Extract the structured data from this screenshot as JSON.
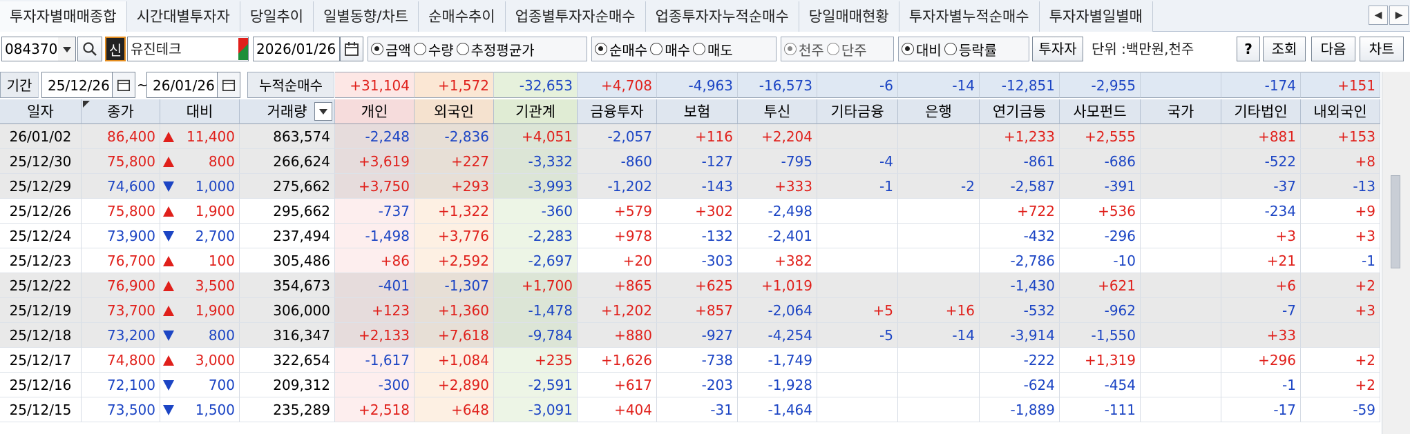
{
  "tabs": [
    "투자자별매매종합",
    "시간대별투자자",
    "당일추이",
    "일별동향/차트",
    "순매수추이",
    "업종별투자자순매수",
    "업종투자자누적순매수",
    "당일매매현황",
    "투자자별누적순매수",
    "투자자별일별매"
  ],
  "tab_arrows": {
    "left": "◀",
    "right": "▶"
  },
  "toolbar": {
    "code": "084370",
    "credit_badge": "신",
    "stock_name": "유진테크",
    "date": "2026/01/26",
    "unit_label": "단위 :백만원,천주",
    "investor_button": "투자자",
    "help_button": "?",
    "query_button": "조회",
    "next_button": "다음",
    "chart_button": "차트",
    "radio_groups": [
      [
        {
          "label": "금액",
          "checked": true
        },
        {
          "label": "수량",
          "checked": false
        },
        {
          "label": "추정평균가",
          "checked": false
        }
      ],
      [
        {
          "label": "순매수",
          "checked": true
        },
        {
          "label": "매수",
          "checked": false
        },
        {
          "label": "매도",
          "checked": false
        }
      ],
      [
        {
          "label": "천주",
          "checked": true
        },
        {
          "label": "단주",
          "checked": false
        }
      ],
      [
        {
          "label": "대비",
          "checked": true
        },
        {
          "label": "등락률",
          "checked": false
        }
      ]
    ]
  },
  "period": {
    "label": "기간",
    "from": "25/12/26",
    "tilde": "~",
    "to": "26/01/26",
    "cumulative_label": "누적순매수"
  },
  "summary_values": [
    "+31,104",
    "+1,572",
    "-32,653",
    "+4,708",
    "-4,963",
    "-16,573",
    "-6",
    "-14",
    "-12,851",
    "-2,955",
    "",
    "-174",
    "+151"
  ],
  "columns": [
    "일자",
    "종가",
    "대비",
    "거래량",
    "개인",
    "외국인",
    "기관계",
    "금융투자",
    "보험",
    "투신",
    "기타금융",
    "은행",
    "연기금등",
    "사모펀드",
    "국가",
    "기타법인",
    "내외국인"
  ],
  "rows": [
    {
      "date": "26/01/02",
      "close": "86,400",
      "dir": "up",
      "change": "11,400",
      "volume": "863,574",
      "vals": [
        "-2,248",
        "-2,836",
        "+4,051",
        "-2,057",
        "+116",
        "+2,204",
        "",
        "",
        "+1,233",
        "+2,555",
        "",
        "+881",
        "+153"
      ]
    },
    {
      "date": "25/12/30",
      "close": "75,800",
      "dir": "up",
      "change": "800",
      "volume": "266,624",
      "vals": [
        "+3,619",
        "+227",
        "-3,332",
        "-860",
        "-127",
        "-795",
        "-4",
        "",
        "-861",
        "-686",
        "",
        "-522",
        "+8"
      ]
    },
    {
      "date": "25/12/29",
      "close": "74,600",
      "dir": "down",
      "change": "1,000",
      "volume": "275,662",
      "vals": [
        "+3,750",
        "+293",
        "-3,993",
        "-1,202",
        "-143",
        "+333",
        "-1",
        "-2",
        "-2,587",
        "-391",
        "",
        "-37",
        "-13"
      ]
    },
    {
      "date": "25/12/26",
      "close": "75,800",
      "dir": "up",
      "change": "1,900",
      "volume": "295,662",
      "vals": [
        "-737",
        "+1,322",
        "-360",
        "+579",
        "+302",
        "-2,498",
        "",
        "",
        "+722",
        "+536",
        "",
        "-234",
        "+9"
      ]
    },
    {
      "date": "25/12/24",
      "close": "73,900",
      "dir": "down",
      "change": "2,700",
      "volume": "237,494",
      "vals": [
        "-1,498",
        "+3,776",
        "-2,283",
        "+978",
        "-132",
        "-2,401",
        "",
        "",
        "-432",
        "-296",
        "",
        "+3",
        "+3"
      ]
    },
    {
      "date": "25/12/23",
      "close": "76,700",
      "dir": "up",
      "change": "100",
      "volume": "305,486",
      "vals": [
        "+86",
        "+2,592",
        "-2,697",
        "+20",
        "-303",
        "+382",
        "",
        "",
        "-2,786",
        "-10",
        "",
        "+21",
        "-1"
      ]
    },
    {
      "date": "25/12/22",
      "close": "76,900",
      "dir": "up",
      "change": "3,500",
      "volume": "354,673",
      "vals": [
        "-401",
        "-1,307",
        "+1,700",
        "+865",
        "+625",
        "+1,019",
        "",
        "",
        "-1,430",
        "+621",
        "",
        "+6",
        "+2"
      ]
    },
    {
      "date": "25/12/19",
      "close": "73,700",
      "dir": "up",
      "change": "1,900",
      "volume": "306,000",
      "vals": [
        "+123",
        "+1,360",
        "-1,478",
        "+1,202",
        "+857",
        "-2,064",
        "+5",
        "+16",
        "-532",
        "-962",
        "",
        "-7",
        "+3"
      ]
    },
    {
      "date": "25/12/18",
      "close": "73,200",
      "dir": "down",
      "change": "800",
      "volume": "316,347",
      "vals": [
        "+2,133",
        "+7,618",
        "-9,784",
        "+880",
        "-927",
        "-4,254",
        "-5",
        "-14",
        "-3,914",
        "-1,550",
        "",
        "+33",
        ""
      ]
    },
    {
      "date": "25/12/17",
      "close": "74,800",
      "dir": "up",
      "change": "3,000",
      "volume": "322,654",
      "vals": [
        "-1,617",
        "+1,084",
        "+235",
        "+1,626",
        "-738",
        "-1,749",
        "",
        "",
        "-222",
        "+1,319",
        "",
        "+296",
        "+2"
      ]
    },
    {
      "date": "25/12/16",
      "close": "72,100",
      "dir": "down",
      "change": "700",
      "volume": "209,312",
      "vals": [
        "-300",
        "+2,890",
        "-2,591",
        "+617",
        "-203",
        "-1,928",
        "",
        "",
        "-624",
        "-454",
        "",
        "-1",
        "+2"
      ]
    },
    {
      "date": "25/12/15",
      "close": "73,500",
      "dir": "down",
      "change": "1,500",
      "volume": "235,289",
      "vals": [
        "+2,518",
        "+648",
        "-3,091",
        "+404",
        "-31",
        "-1,464",
        "",
        "",
        "-1,889",
        "-111",
        "",
        "-17",
        "-59"
      ]
    }
  ],
  "colors": {
    "positive": "#e0201b",
    "negative": "#1c45c4",
    "header_bg": "#dfe6ef",
    "row_alt_bg": "#e9e9e9"
  }
}
